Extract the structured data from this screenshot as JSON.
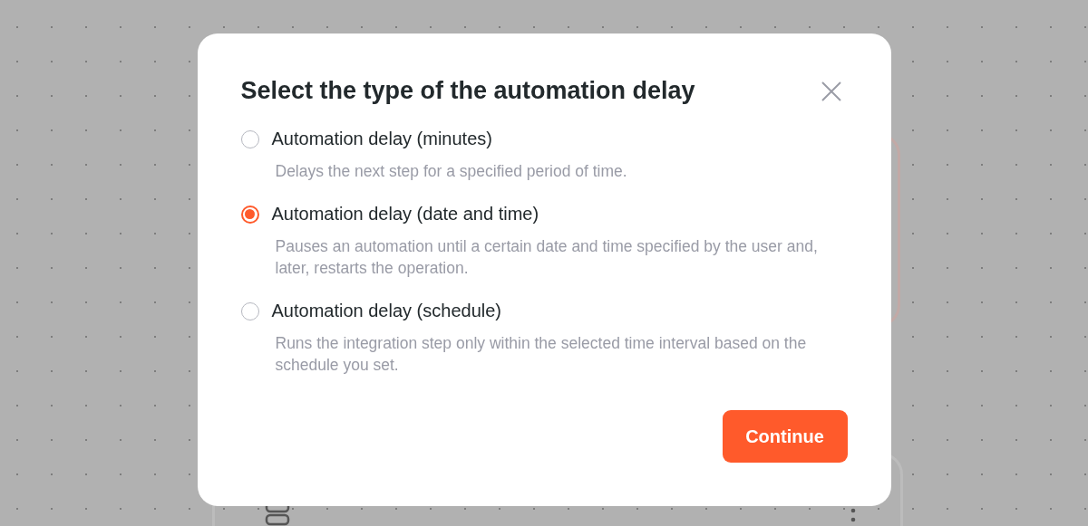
{
  "dialog": {
    "title": "Select the type of the automation delay",
    "options": [
      {
        "label": "Automation delay (minutes)",
        "description": "Delays the next step for a specified period of time.",
        "selected": false
      },
      {
        "label": "Automation delay (date and time)",
        "description": "Pauses an automation until a certain date and time specified by the user and, later, restarts the operation.",
        "selected": true
      },
      {
        "label": "Automation delay (schedule)",
        "description": "Runs the integration step only within the selected time interval based on the schedule you set.",
        "selected": false
      }
    ],
    "button": "Continue"
  }
}
